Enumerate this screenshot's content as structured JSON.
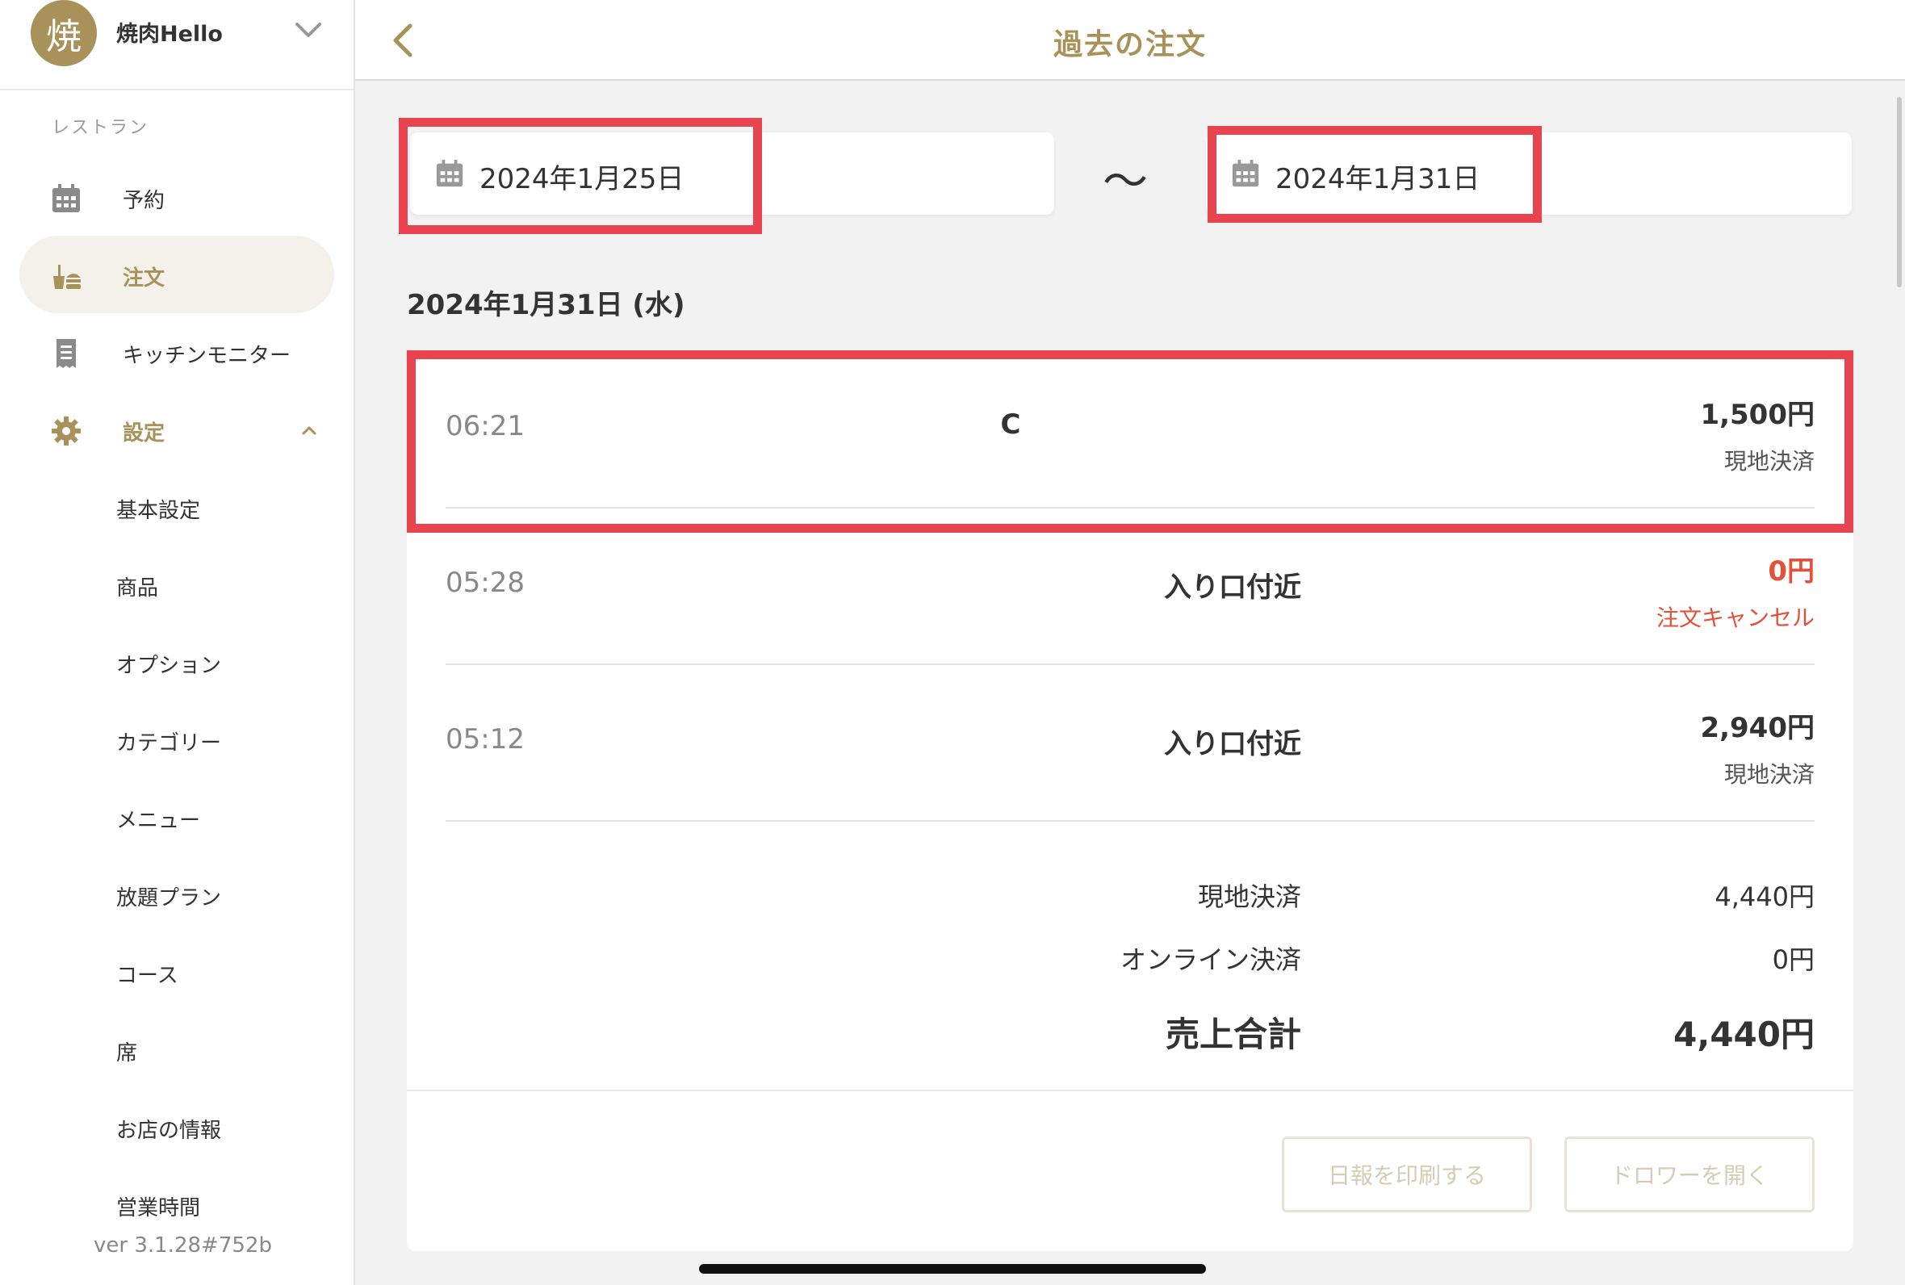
{
  "account": {
    "avatar_char": "焼",
    "name": "焼肉Hello"
  },
  "sidebar": {
    "section_label": "レストラン",
    "items": [
      {
        "label": "予約",
        "icon": "calendar-icon"
      },
      {
        "label": "注文",
        "icon": "order-icon",
        "active": true
      },
      {
        "label": "キッチンモニター",
        "icon": "receipt-icon"
      },
      {
        "label": "設定",
        "icon": "gear-icon",
        "expanded": true
      }
    ],
    "sub_items": [
      "基本設定",
      "商品",
      "オプション",
      "カテゴリー",
      "メニュー",
      "放題プラン",
      "コース",
      "席",
      "お店の情報",
      "営業時間"
    ],
    "version": "ver 3.1.28#752b"
  },
  "header": {
    "title": "過去の注文"
  },
  "date_range": {
    "from": "2024年1月25日",
    "to": "2024年1月31日",
    "separator": "〜"
  },
  "day": {
    "heading": "2024年1月31日 (水)",
    "orders": [
      {
        "time": "06:21",
        "seat": "C",
        "amount": "1,500円",
        "status": "現地決済",
        "cancelled": false
      },
      {
        "time": "05:28",
        "seat": "入り口付近",
        "amount": "0円",
        "status": "注文キャンセル",
        "cancelled": true
      },
      {
        "time": "05:12",
        "seat": "入り口付近",
        "amount": "2,940円",
        "status": "現地決済",
        "cancelled": false
      }
    ],
    "summary": {
      "onsite_label": "現地決済",
      "onsite_value": "4,440円",
      "online_label": "オンライン決済",
      "online_value": "0円",
      "total_label": "売上合計",
      "total_value": "4,440円"
    }
  },
  "actions": {
    "print_report": "日報を印刷する",
    "open_drawer": "ドロワーを開く"
  },
  "colors": {
    "accent": "#a8925a",
    "highlight": "#e8434f",
    "cancel": "#e2503a"
  }
}
